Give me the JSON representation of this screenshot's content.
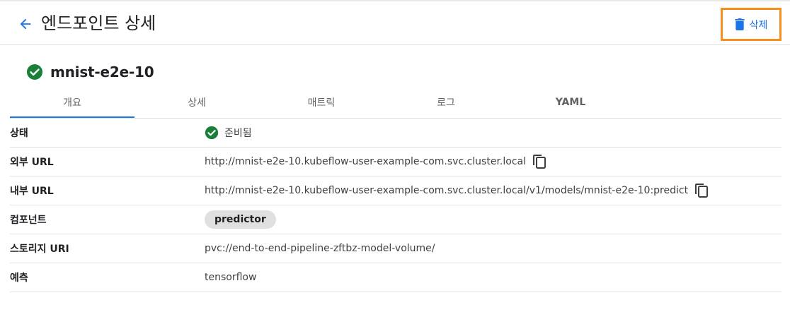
{
  "header": {
    "title": "엔드포인트 상세",
    "delete_label": "삭제"
  },
  "endpoint": {
    "name": "mnist-e2e-10",
    "status_icon": "check-circle-icon",
    "status_color": "#188038"
  },
  "tabs": [
    {
      "label": "개요",
      "active": true
    },
    {
      "label": "상세",
      "active": false
    },
    {
      "label": "매트릭",
      "active": false
    },
    {
      "label": "로그",
      "active": false
    },
    {
      "label": "YAML",
      "active": false
    }
  ],
  "details": {
    "status": {
      "label": "상태",
      "value": "준비됨"
    },
    "external_url": {
      "label": "외부 URL",
      "value": "http://mnist-e2e-10.kubeflow-user-example-com.svc.cluster.local"
    },
    "internal_url": {
      "label": "내부 URL",
      "value": "http://mnist-e2e-10.kubeflow-user-example-com.svc.cluster.local/v1/models/mnist-e2e-10:predict"
    },
    "components": {
      "label": "컴포넌트",
      "value": "predictor"
    },
    "storage_uri": {
      "label": "스토리지 URI",
      "value": "pvc://end-to-end-pipeline-zftbz-model-volume/"
    },
    "predictor": {
      "label": "예측",
      "value": "tensorflow"
    }
  },
  "colors": {
    "accent": "#1a73e8",
    "highlight_border": "#f5901e",
    "success": "#188038"
  }
}
